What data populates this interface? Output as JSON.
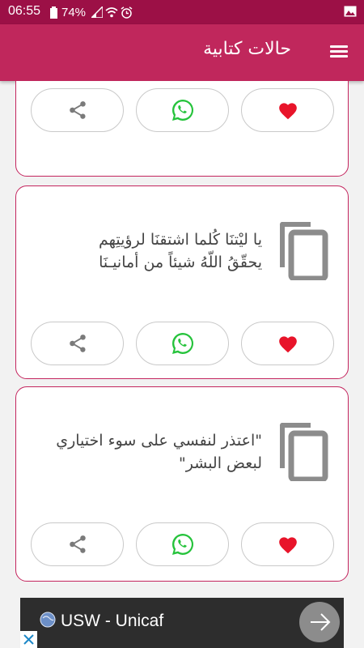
{
  "status_bar": {
    "time": "06:55",
    "battery": "74%"
  },
  "app_bar": {
    "title": "حالات كتابية"
  },
  "cards": [
    {
      "text_lines": []
    },
    {
      "text_lines": [
        "يا ليْتنَا كُلما اشتقنَا لرؤيتِهم",
        "يحقّقُ اللّهُ شيئاً من أمانيـنَا"
      ]
    },
    {
      "text_lines": [
        "\"اعتذر لنفسي على سوء اختياري",
        "لبعض البشر\""
      ]
    }
  ],
  "ad": {
    "text": "USW - Unicaf"
  },
  "colors": {
    "status_bar": "#9c1046",
    "app_bar": "#c0275c",
    "card_border": "#c4255e",
    "heart": "#e8142a",
    "whatsapp": "#25c33b"
  },
  "icons": [
    "menu-icon",
    "copy-icon",
    "share-icon",
    "whatsapp-icon",
    "heart-icon",
    "arrow-right-icon"
  ]
}
